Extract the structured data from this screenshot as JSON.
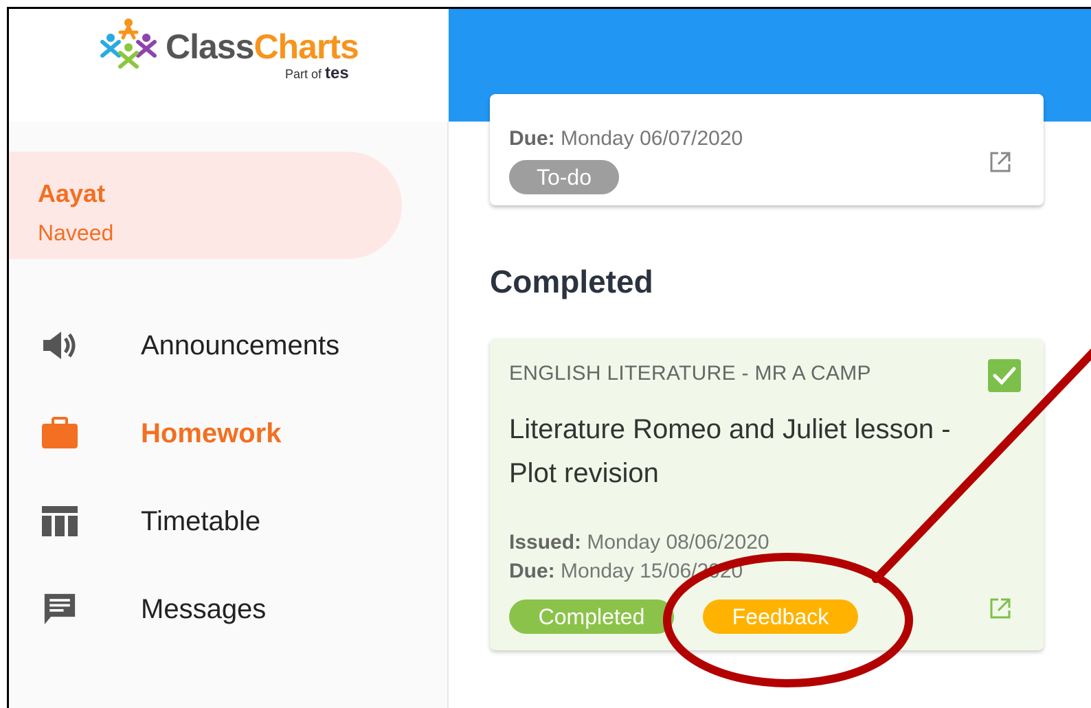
{
  "brand": {
    "name_part1": "Class",
    "name_part2": "Charts",
    "tagline_prefix": "Part of",
    "tagline_brand": "tes",
    "accent_color": "#f36f21",
    "topbar_color": "#2196f3"
  },
  "user": {
    "first_name": "Aayat",
    "last_name": "Naveed"
  },
  "sidebar": {
    "items": [
      {
        "label": "Announcements",
        "icon": "megaphone-icon",
        "active": false
      },
      {
        "label": "Homework",
        "icon": "briefcase-icon",
        "active": true
      },
      {
        "label": "Timetable",
        "icon": "timetable-icon",
        "active": false
      },
      {
        "label": "Messages",
        "icon": "message-icon",
        "active": false
      }
    ]
  },
  "main": {
    "todo_card": {
      "due_label": "Due:",
      "due_value": "Monday 06/07/2020",
      "status": "To-do"
    },
    "completed_section": {
      "title": "Completed",
      "card": {
        "subject": "ENGLISH LITERATURE - MR A CAMP",
        "title": "Literature Romeo and Juliet lesson - Plot revision",
        "issued_label": "Issued:",
        "issued_value": "Monday 08/06/2020",
        "due_label": "Due:",
        "due_value": "Monday 15/06/2020",
        "status": "Completed",
        "feedback": "Feedback",
        "completed_color": "#8bc34a",
        "feedback_color": "#ffb300"
      }
    }
  },
  "annotation": {
    "color": "#b30000"
  }
}
